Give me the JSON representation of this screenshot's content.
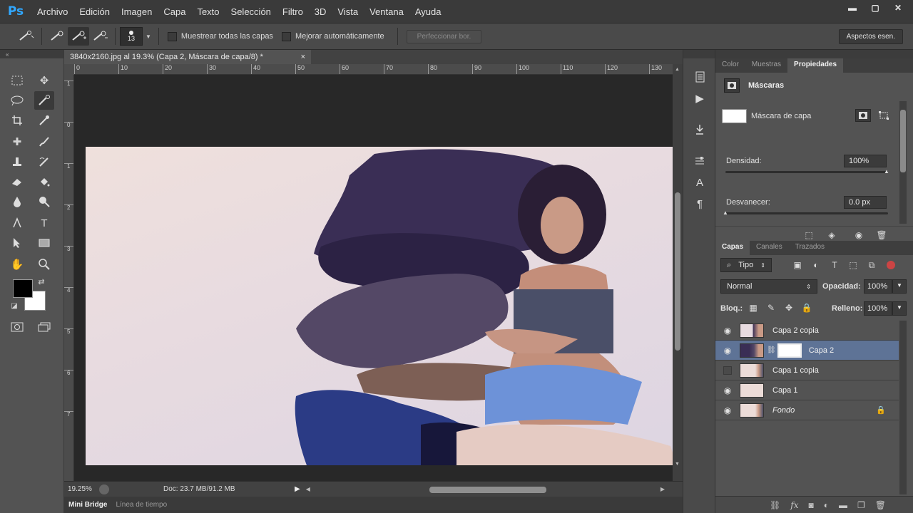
{
  "app": {
    "logo": "Ps"
  },
  "menu": [
    "Archivo",
    "Edición",
    "Imagen",
    "Capa",
    "Texto",
    "Selección",
    "Filtro",
    "3D",
    "Vista",
    "Ventana",
    "Ayuda"
  ],
  "window_controls": {
    "minimize": "▬",
    "maximize": "▢",
    "close": "✕"
  },
  "options": {
    "brush_size": "13",
    "sample_all_layers": "Muestrear todas las capas",
    "auto_enhance": "Mejorar automáticamente",
    "refine_edge": "Perfeccionar bor.",
    "workspace": "Aspectos esen."
  },
  "document": {
    "tab_title": "3840x2160.jpg al 19.3% (Capa 2, Máscara de capa/8) *",
    "close": "×",
    "ruler_h": [
      "0",
      "10",
      "20",
      "30",
      "40",
      "50",
      "60",
      "70",
      "80",
      "90",
      "100",
      "110",
      "120",
      "130"
    ],
    "ruler_v": [
      "1",
      "0",
      "1",
      "2",
      "3",
      "4",
      "5",
      "6",
      "7"
    ],
    "zoom": "19.25%",
    "doc_size": "Doc: 23.7 MB/91.2 MB"
  },
  "bottom_tabs": [
    "Mini Bridge",
    "Línea de tiempo"
  ],
  "properties": {
    "tabs": [
      "Color",
      "Muestras",
      "Propiedades"
    ],
    "active_tab": "Propiedades",
    "title": "Máscaras",
    "mask_label": "Máscara de capa",
    "density_label": "Densidad:",
    "density_value": "100%",
    "feather_label": "Desvanecer:",
    "feather_value": "0.0 px"
  },
  "layers": {
    "tabs": [
      "Capas",
      "Canales",
      "Trazados"
    ],
    "filter": "Tipo",
    "blend_mode": "Normal",
    "opacity_label": "Opacidad:",
    "opacity_value": "100%",
    "lock_label": "Bloq.:",
    "fill_label": "Relleno:",
    "fill_value": "100%",
    "items": [
      {
        "name": "Capa 2 copia",
        "visible": true
      },
      {
        "name": "Capa 2",
        "visible": true,
        "selected": true
      },
      {
        "name": "Capa 1 copia",
        "visible": false
      },
      {
        "name": "Capa 1",
        "visible": true
      },
      {
        "name": "Fondo",
        "visible": true,
        "locked": true
      }
    ]
  },
  "colors": {
    "accent": "#31a8ff",
    "selected_row": "#5e7396",
    "foreground": "#000000",
    "background": "#ffffff"
  }
}
